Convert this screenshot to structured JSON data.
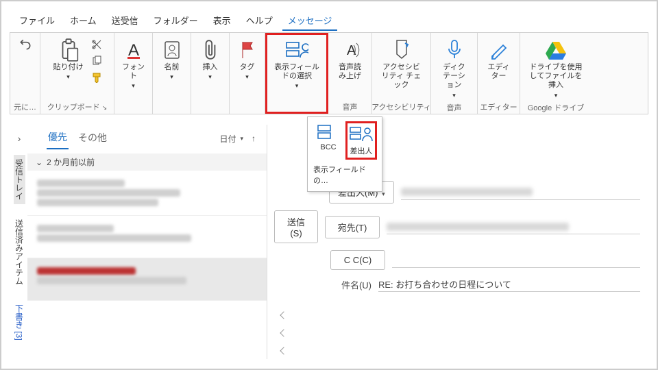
{
  "tabs": {
    "file": "ファイル",
    "home": "ホーム",
    "sendrecv": "送受信",
    "folder": "フォルダー",
    "view": "表示",
    "help": "ヘルプ",
    "message": "メッセージ"
  },
  "ribbon": {
    "undo_group": "元に…",
    "paste": "貼り付け",
    "clipboard_group": "クリップボード",
    "font": "フォント",
    "names": "名前",
    "insert": "挿入",
    "tag": "タグ",
    "show_fields": "表示フィールドの選択",
    "read_aloud": "音声読み上げ",
    "voice_group": "音声",
    "a11y": "アクセシビリティ チェック",
    "a11y_group": "アクセシビリティ",
    "dictation": "ディクテーション",
    "voice_group2": "音声",
    "editor": "エディター",
    "editor_group": "エディター",
    "drive": "ドライブを使用してファイルを挿入",
    "drive_group": "Google ドライブ"
  },
  "dropdown": {
    "bcc": "BCC",
    "from": "差出人",
    "label": "表示フィールドの…"
  },
  "rail": {
    "inbox": "受信トレイ",
    "sent": "送信済みアイテム",
    "drafts": "下書き [3]"
  },
  "listpane": {
    "tab_focused": "優先",
    "tab_other": "その他",
    "sort": "日付",
    "section": "2 か月前以前"
  },
  "compose": {
    "from_btn": "差出人(M)",
    "send_btn": "送信(S)",
    "to_btn": "宛先(T)",
    "cc_btn": "C C(C)",
    "subject_label": "件名(U)",
    "subject_value": "RE: お打ち合わせの日程について"
  }
}
